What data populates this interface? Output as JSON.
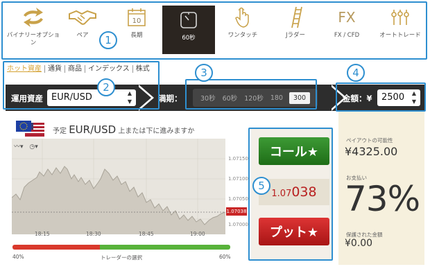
{
  "product_tabs": [
    {
      "label": "バイナリーオプション",
      "icon": "arrows-cycle-icon"
    },
    {
      "label": "ペア",
      "icon": "handshake-icon"
    },
    {
      "label": "長期",
      "icon": "calendar-icon",
      "calendar_day": "10"
    },
    {
      "label": "60秒",
      "icon": "clock-face-icon",
      "active": true
    },
    {
      "label": "ワンタッチ",
      "icon": "touch-hand-icon"
    },
    {
      "label": "Jラダー",
      "icon": "ladder-icon"
    },
    {
      "label": "FX / CFD",
      "icon": "fx-text-icon",
      "icon_text": "FX"
    },
    {
      "label": "オートトレード",
      "icon": "sliders-icon"
    }
  ],
  "asset_tabs": [
    "ホット資産",
    "通貨",
    "商品",
    "インデックス",
    "株式"
  ],
  "controls": {
    "asset_label": "運用資産",
    "asset_value": "EUR/USD",
    "expiry_label": "満期：",
    "expiry_options": [
      "30秒",
      "60秒",
      "120秒",
      "180",
      "300"
    ],
    "expiry_selected": "300",
    "amount_label": "金額：¥",
    "amount_value": "2500"
  },
  "chart": {
    "prefix": "予定",
    "pair": "EUR/USD",
    "question": "上または下に進みますか",
    "y_ticks": [
      "1.07150",
      "1.07100",
      "1.07050",
      "1.07000"
    ],
    "x_ticks": [
      "18:15",
      "18:30",
      "18:45",
      "19:00"
    ],
    "current_price_tag": "1.07038",
    "sentiment_left": "40%",
    "sentiment_right": "60%",
    "sentiment_label": "トレーダーの選択",
    "sentiment_put_fraction": 0.4,
    "sentiment_call_fraction": 0.6
  },
  "trade": {
    "call_label": "コール★",
    "put_label": "プット★",
    "price_prefix": "1.07",
    "price_suffix": "038"
  },
  "info": {
    "payout_label": "ペイアウトの可能性",
    "payout_value": "¥4325.00",
    "payment_label": "お支払い",
    "percent_value": "73%",
    "guaranteed_label": "保護された金額",
    "guaranteed_value": "¥0.00"
  },
  "annotations": [
    "1",
    "2",
    "3",
    "4",
    "5"
  ],
  "colors": {
    "annotation_blue": "#2e8fd0",
    "call_green": "#2e8a26",
    "put_red": "#c42020",
    "gold": "#d4a233",
    "dark_strip": "#2d2d2d"
  }
}
